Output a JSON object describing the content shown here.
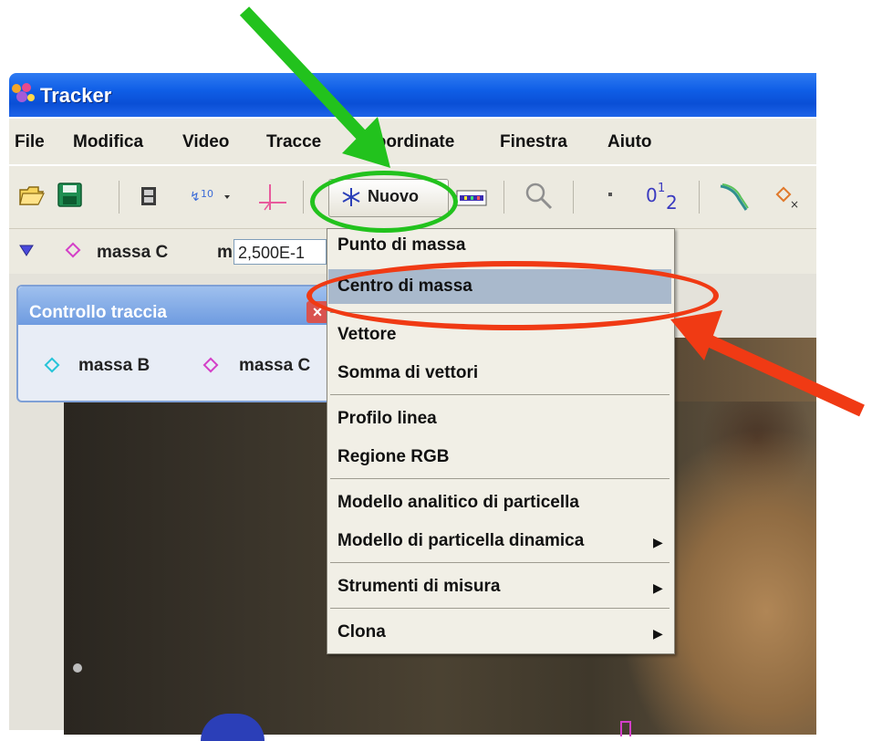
{
  "window": {
    "title": "Tracker"
  },
  "menubar": {
    "items": [
      {
        "label": "File"
      },
      {
        "label": "Modifica"
      },
      {
        "label": "Video"
      },
      {
        "label": "Tracce"
      },
      {
        "label": "Coordinate"
      },
      {
        "label": "Finestra"
      },
      {
        "label": "Aiuto"
      }
    ]
  },
  "toolbar": {
    "new_label": "Nuovo",
    "zero_label": "0",
    "one_label": "1",
    "two_label": "2",
    "icons": [
      "open-folder-icon",
      "save-icon",
      "video-clip-icon",
      "calibration-icon",
      "axes-icon",
      "new-asterisk-icon",
      "track-color-icon",
      "zoom-icon",
      "point-icon",
      "number-tracks-icon",
      "curve-icon",
      "mark-icon"
    ]
  },
  "trackbar": {
    "track_name": "massa C",
    "mass_label": "m",
    "mass_value": "2,500E-1"
  },
  "control_panel": {
    "title": "Controllo traccia",
    "tracks": [
      {
        "name": "massa B",
        "color": "#25c4d8"
      },
      {
        "name": "massa C",
        "color": "#d43fc8"
      }
    ]
  },
  "new_menu": {
    "items": [
      {
        "label": "Punto di massa"
      },
      {
        "label": "Centro di massa"
      },
      {
        "label": "Vettore"
      },
      {
        "label": "Somma di vettori"
      },
      {
        "label": "Profilo linea"
      },
      {
        "label": "Regione RGB"
      },
      {
        "label": "Modello analitico di particella"
      },
      {
        "label": "Modello di particella dinamica"
      },
      {
        "label": "Strumenti di misura"
      },
      {
        "label": "Clona"
      }
    ],
    "highlighted": "Centro di massa"
  },
  "colors": {
    "titlebar": "#0a4fd6",
    "menu_bg": "#eceae0",
    "highlight": "#a9b9cc",
    "annotation_green": "#22c21d",
    "annotation_red": "#f03a14"
  }
}
